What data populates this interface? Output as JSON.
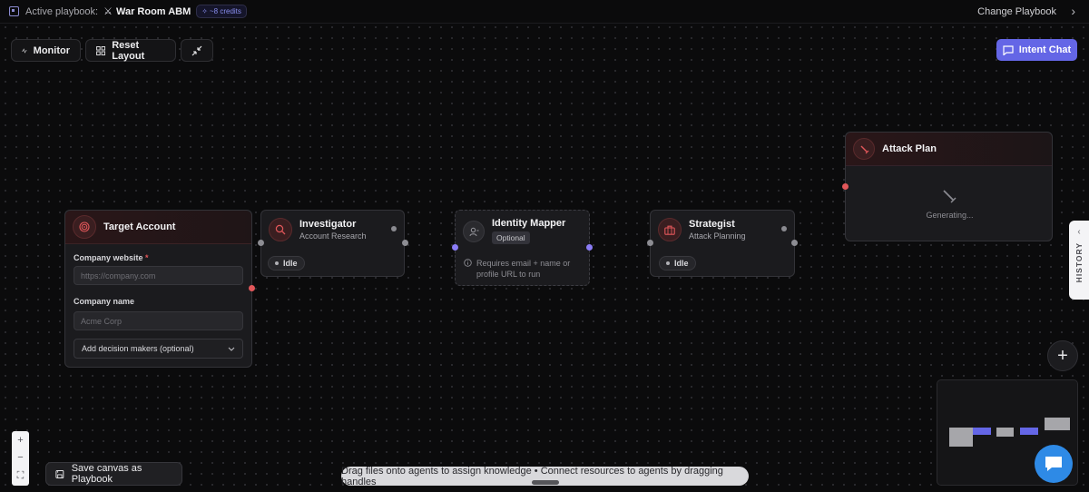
{
  "topbar": {
    "active_label": "Active playbook:",
    "playbook_name": "War Room ABM",
    "credits": "~8 credits",
    "change_playbook": "Change Playbook"
  },
  "toolbar": {
    "monitor": "Monitor",
    "reset_layout": "Reset Layout",
    "intent_chat": "Intent Chat"
  },
  "nodes": {
    "target_account": {
      "title": "Target Account",
      "website_label": "Company website",
      "required_mark": "*",
      "website_placeholder": "https://company.com",
      "name_label": "Company name",
      "name_placeholder": "Acme Corp",
      "decision_makers": "Add decision makers (optional)"
    },
    "investigator": {
      "title": "Investigator",
      "subtitle": "Account Research",
      "status": "Idle"
    },
    "identity_mapper": {
      "title": "Identity Mapper",
      "tag": "Optional",
      "note": "Requires email + name or profile URL to run"
    },
    "strategist": {
      "title": "Strategist",
      "subtitle": "Attack Planning",
      "status": "Idle"
    },
    "attack_plan": {
      "title": "Attack Plan",
      "status": "Generating..."
    }
  },
  "history_label": "HISTORY",
  "save_canvas": "Save canvas as Playbook",
  "hint": "Drag files onto agents to assign knowledge • Connect resources to agents by dragging handles",
  "colors": {
    "accent": "#6466e6",
    "danger": "#e2575a",
    "handle_purple": "#8b7cf6",
    "chat_fab": "#2e8ae6"
  }
}
